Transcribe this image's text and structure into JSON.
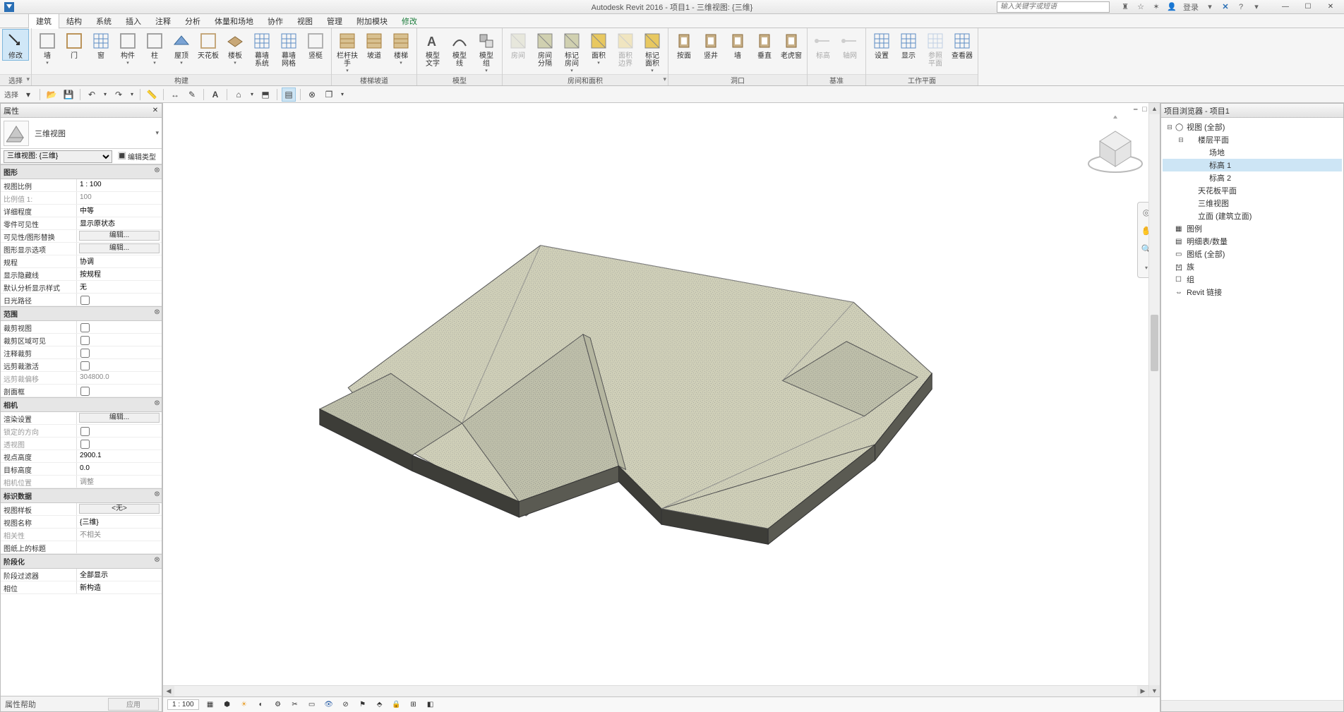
{
  "app": {
    "title": "Autodesk Revit 2016 -   项目1 - 三维视图: {三维}",
    "search_placeholder": "输入关键字或短语",
    "login": "登录"
  },
  "menu_tabs": [
    "建筑",
    "结构",
    "系统",
    "插入",
    "注释",
    "分析",
    "体量和场地",
    "协作",
    "视图",
    "管理",
    "附加模块",
    "修改"
  ],
  "menu_active": "建筑",
  "ribbon": {
    "select": {
      "label": "选择",
      "modify": "修改"
    },
    "build": {
      "label": "构建",
      "items": [
        "墙",
        "门",
        "窗",
        "构件",
        "柱",
        "屋顶",
        "天花板",
        "楼板",
        "幕墙\n系统",
        "幕墙\n网格",
        "竖梃"
      ]
    },
    "circulation": {
      "label": "楼梯坡道",
      "items": [
        "栏杆扶手",
        "坡道",
        "楼梯"
      ]
    },
    "model": {
      "label": "模型",
      "items": [
        "模型\n文字",
        "模型\n线",
        "模型\n组"
      ]
    },
    "room_area": {
      "label": "房间和面积",
      "items": [
        {
          "l": "房间",
          "d": true
        },
        {
          "l": "房间\n分隔",
          "d": false
        },
        {
          "l": "标记\n房间",
          "d": false
        },
        {
          "l": "面积",
          "d": false
        },
        {
          "l": "面积\n边界",
          "d": true
        },
        {
          "l": "标记\n面积",
          "d": false
        }
      ]
    },
    "opening": {
      "label": "洞口",
      "items": [
        "按面",
        "竖井",
        "墙",
        "垂直",
        "老虎窗"
      ]
    },
    "datum": {
      "label": "基准",
      "items": [
        {
          "l": "标高",
          "d": true
        },
        {
          "l": "轴网",
          "d": true
        }
      ]
    },
    "workplane": {
      "label": "工作平面",
      "items": [
        "设置",
        "显示",
        "参照\n平面",
        "查看器"
      ]
    }
  },
  "props": {
    "title": "属性",
    "type_name": "三维视图",
    "instance_selector": "三维视图: {三维}",
    "edit_type": "编辑类型",
    "footer_help": "属性帮助",
    "footer_apply": "应用",
    "categories": [
      {
        "name": "图形",
        "rows": [
          {
            "k": "视图比例",
            "v": "1 : 100",
            "t": "text"
          },
          {
            "k": "比例值 1:",
            "v": "100",
            "t": "text",
            "dis": true
          },
          {
            "k": "详细程度",
            "v": "中等",
            "t": "text"
          },
          {
            "k": "零件可见性",
            "v": "显示原状态",
            "t": "text"
          },
          {
            "k": "可见性/图形替换",
            "v": "编辑...",
            "t": "btn"
          },
          {
            "k": "图形显示选项",
            "v": "编辑...",
            "t": "btn"
          },
          {
            "k": "规程",
            "v": "协调",
            "t": "text"
          },
          {
            "k": "显示隐藏线",
            "v": "按规程",
            "t": "text"
          },
          {
            "k": "默认分析显示样式",
            "v": "无",
            "t": "text"
          },
          {
            "k": "日光路径",
            "v": "",
            "t": "check"
          }
        ]
      },
      {
        "name": "范围",
        "rows": [
          {
            "k": "裁剪视图",
            "v": "",
            "t": "check"
          },
          {
            "k": "裁剪区域可见",
            "v": "",
            "t": "check"
          },
          {
            "k": "注释裁剪",
            "v": "",
            "t": "check"
          },
          {
            "k": "远剪裁激活",
            "v": "",
            "t": "check"
          },
          {
            "k": "远剪裁偏移",
            "v": "304800.0",
            "t": "text",
            "dis": true
          },
          {
            "k": "剖面框",
            "v": "",
            "t": "check"
          }
        ]
      },
      {
        "name": "相机",
        "rows": [
          {
            "k": "渲染设置",
            "v": "编辑...",
            "t": "btn"
          },
          {
            "k": "锁定的方向",
            "v": "",
            "t": "check",
            "dis": true
          },
          {
            "k": "透视图",
            "v": "",
            "t": "check",
            "dis": true
          },
          {
            "k": "视点高度",
            "v": "2900.1",
            "t": "text"
          },
          {
            "k": "目标高度",
            "v": "0.0",
            "t": "text"
          },
          {
            "k": "相机位置",
            "v": "调整",
            "t": "text",
            "dis": true
          }
        ]
      },
      {
        "name": "标识数据",
        "rows": [
          {
            "k": "视图样板",
            "v": "<无>",
            "t": "btn"
          },
          {
            "k": "视图名称",
            "v": "{三维}",
            "t": "text"
          },
          {
            "k": "相关性",
            "v": "不相关",
            "t": "text",
            "dis": true
          },
          {
            "k": "图纸上的标题",
            "v": "",
            "t": "text"
          }
        ]
      },
      {
        "name": "阶段化",
        "rows": [
          {
            "k": "阶段过滤器",
            "v": "全部显示",
            "t": "text"
          },
          {
            "k": "相位",
            "v": "新构造",
            "t": "text"
          }
        ]
      }
    ]
  },
  "view_status": {
    "scale": "1 : 100"
  },
  "browser": {
    "title": "项目浏览器 - 项目1",
    "tree": [
      {
        "l": "视图 (全部)",
        "exp": true,
        "ic": "◯",
        "children": [
          {
            "l": "楼层平面",
            "exp": true,
            "children": [
              {
                "l": "场地"
              },
              {
                "l": "标高 1",
                "sel": true
              },
              {
                "l": "标高 2"
              }
            ]
          },
          {
            "l": "天花板平面",
            "exp": false
          },
          {
            "l": "三维视图",
            "exp": false
          },
          {
            "l": "立面 (建筑立面)",
            "exp": false
          }
        ]
      },
      {
        "l": "图例",
        "ic": "▦"
      },
      {
        "l": "明细表/数量",
        "ic": "▤",
        "exp": false
      },
      {
        "l": "图纸 (全部)",
        "ic": "▭"
      },
      {
        "l": "族",
        "ic": "凹",
        "exp": false
      },
      {
        "l": "组",
        "ic": "☐",
        "exp": false
      },
      {
        "l": "Revit 链接",
        "ic": "⇔"
      }
    ]
  }
}
